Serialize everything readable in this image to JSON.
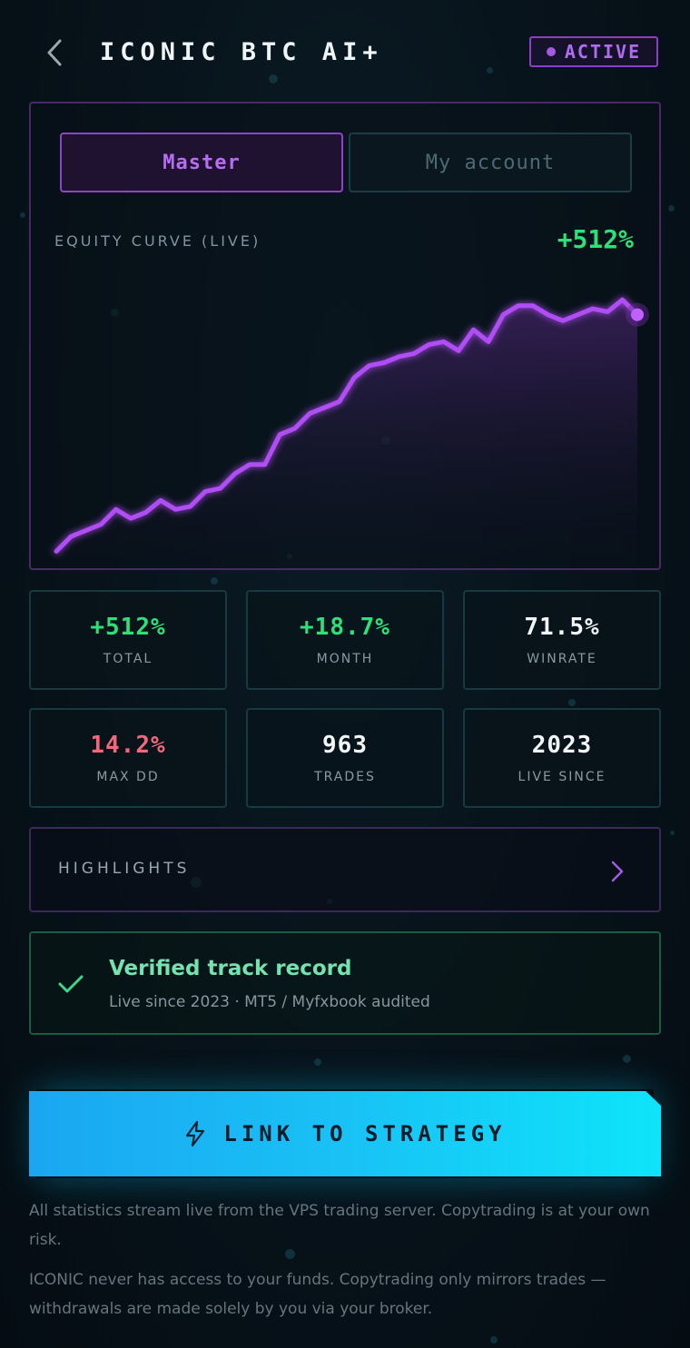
{
  "header": {
    "title": "ICONIC BTC AI+",
    "status": "ACTIVE",
    "accent": "#a35ae0"
  },
  "tabs": [
    {
      "label": "Master",
      "selected": true
    },
    {
      "label": "My account",
      "selected": false
    }
  ],
  "equity": {
    "label": "EQUITY CURVE (LIVE)",
    "value": "+512%"
  },
  "chart_data": {
    "type": "area",
    "title": "",
    "xlabel": "",
    "ylabel": "",
    "grid": false,
    "line_color": "#b14ef5",
    "ylim": [
      0,
      100
    ],
    "series": [
      {
        "values": [
          2,
          7,
          9,
          11,
          16,
          13,
          15,
          19,
          16,
          17,
          22,
          23,
          28,
          31,
          31,
          41,
          43,
          48,
          50,
          52,
          60,
          64,
          65,
          67,
          68,
          71,
          72,
          69,
          76,
          72,
          81,
          84,
          84,
          81,
          79,
          81,
          83,
          82,
          86,
          81
        ]
      }
    ]
  },
  "stats": [
    {
      "value": "+512%",
      "label": "TOTAL",
      "color": "#2ee07a"
    },
    {
      "value": "+18.7%",
      "label": "MONTH",
      "color": "#2ee07a"
    },
    {
      "value": "71.5%",
      "label": "WINRATE",
      "color": "#f2f6f8"
    },
    {
      "value": "14.2%",
      "label": "MAX DD",
      "color": "#f0687a"
    },
    {
      "value": "963",
      "label": "TRADES",
      "color": "#f2f6f8"
    },
    {
      "value": "2023",
      "label": "LIVE SINCE",
      "color": "#f2f6f8"
    }
  ],
  "highlights": {
    "label": "HIGHLIGHTS"
  },
  "verified": {
    "title": "Verified track record",
    "subtitle": "Live since 2023 · MT5 / Myfxbook audited"
  },
  "cta": {
    "label": "LINK TO STRATEGY"
  },
  "notes": [
    "All statistics stream live from the VPS trading server. Copytrading is at your own risk.",
    "ICONIC never has access to your funds. Copytrading only mirrors trades — withdrawals are made solely by you via your broker."
  ]
}
